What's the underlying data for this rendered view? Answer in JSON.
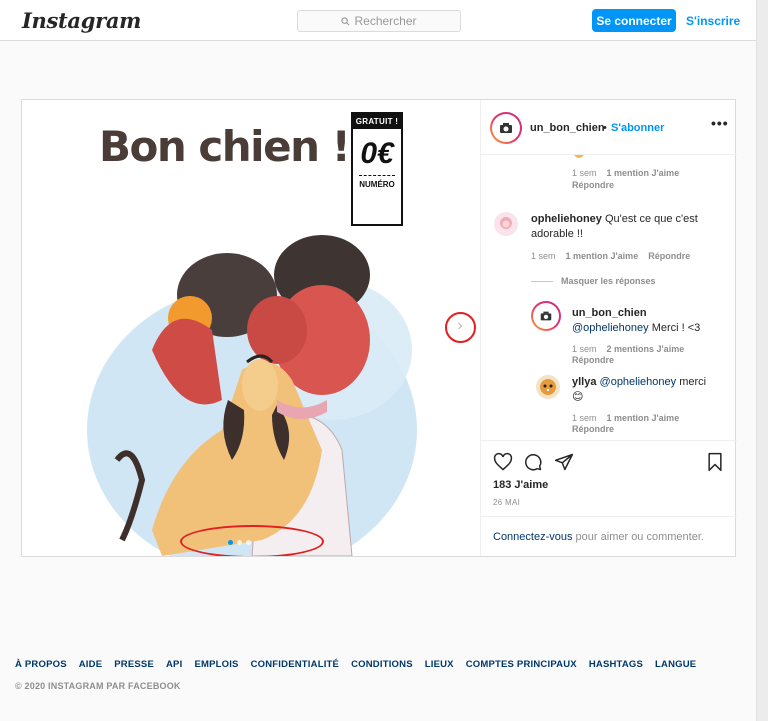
{
  "header": {
    "logo": "Instagram",
    "search_placeholder": "Rechercher",
    "login_label": "Se connecter",
    "signup_label": "S'inscrire"
  },
  "post": {
    "image": {
      "title": "Bon chien !",
      "price_top": "GRATUIT !",
      "price_value": "0€",
      "price_bottom": "NUMÉRO"
    },
    "author": {
      "username": "un_bon_chien",
      "dot": "•",
      "follow_label": "S'abonner",
      "more_label": "•••"
    },
    "comments": [
      {
        "id": "c0",
        "meta_time": "1 sem",
        "meta_likes": "1 mention J'aime",
        "meta_reply": "Répondre"
      },
      {
        "id": "c1",
        "username": "opheliehoney",
        "text": "Qu'est ce que c'est adorable !!",
        "meta_time": "1 sem",
        "meta_likes": "1 mention J'aime",
        "meta_reply": "Répondre"
      },
      {
        "id": "hide",
        "label": "Masquer les réponses"
      },
      {
        "id": "r1",
        "username": "un_bon_chien",
        "mention": "@opheliehoney",
        "text": "Merci ! <3",
        "meta_time": "1 sem",
        "meta_likes": "2 mentions J'aime",
        "meta_reply": "Répondre"
      },
      {
        "id": "r2",
        "username": "yllya",
        "mention": "@opheliehoney",
        "text": "merci",
        "emoji": "😊",
        "meta_time": "1 sem",
        "meta_likes": "1 mention J'aime",
        "meta_reply": "Répondre"
      }
    ],
    "likes": "183 J'aime",
    "date": "26 MAI",
    "login_cta_link": "Connectez-vous",
    "login_cta_text": " pour aimer ou commenter."
  },
  "footer": {
    "links": [
      "À PROPOS",
      "AIDE",
      "PRESSE",
      "API",
      "EMPLOIS",
      "CONFIDENTIALITÉ",
      "CONDITIONS",
      "LIEUX",
      "COMPTES PRINCIPAUX",
      "HASHTAGS",
      "LANGUE"
    ],
    "copyright": "© 2020 INSTAGRAM PAR FACEBOOK"
  },
  "colors": {
    "accent": "#0095f6",
    "annotation": "#e02020"
  }
}
